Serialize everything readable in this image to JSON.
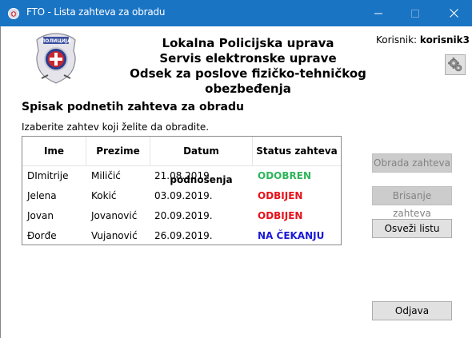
{
  "window": {
    "title": "FTO - Lista zahteva za obradu",
    "controls": {
      "minimize": "—",
      "maximize": "☐",
      "close": "✕"
    },
    "titlebar_color": "#1a74c4"
  },
  "header": {
    "line1": "Lokalna Policijska uprava",
    "line2": "Servis elektronske uprave",
    "line3": "Odsek za poslove fizičko-tehničkog obezbeđenja",
    "logo_text": "ПОЛИЦИЈА",
    "user_prefix": "Korisnik:",
    "username": "korisnik3"
  },
  "main": {
    "title": "Spisak podnetih zahteva za obradu",
    "hint": "Izaberite zahtev koji želite da obradite."
  },
  "table": {
    "columns": [
      "Ime",
      "Prezime",
      "Datum podnošenja",
      "Status zahteva"
    ],
    "rows": [
      {
        "ime": "DImitrije",
        "prezime": "Miličić",
        "datum": "21.08.2019.",
        "status": "ODOBREN"
      },
      {
        "ime": "Jelena",
        "prezime": "Kokić",
        "datum": "03.09.2019.",
        "status": "ODBIJEN"
      },
      {
        "ime": "Jovan",
        "prezime": "Jovanović",
        "datum": "20.09.2019.",
        "status": "ODBIJEN"
      },
      {
        "ime": "Đorđe",
        "prezime": "Vujanović",
        "datum": "26.09.2019.",
        "status": "NA ČEKANJU"
      }
    ],
    "status_colors": {
      "ODOBREN": "#2eb45a",
      "ODBIJEN": "#e8101a",
      "NA ČEKANJU": "#1a1ad6"
    }
  },
  "buttons": {
    "obrada": "Obrada zahteva",
    "brisanje": "Brisanje zahteva",
    "osvezi": "Osveži listu",
    "odjava": "Odjava"
  },
  "icons": {
    "app": "police-badge-icon",
    "settings": "gears-icon"
  }
}
